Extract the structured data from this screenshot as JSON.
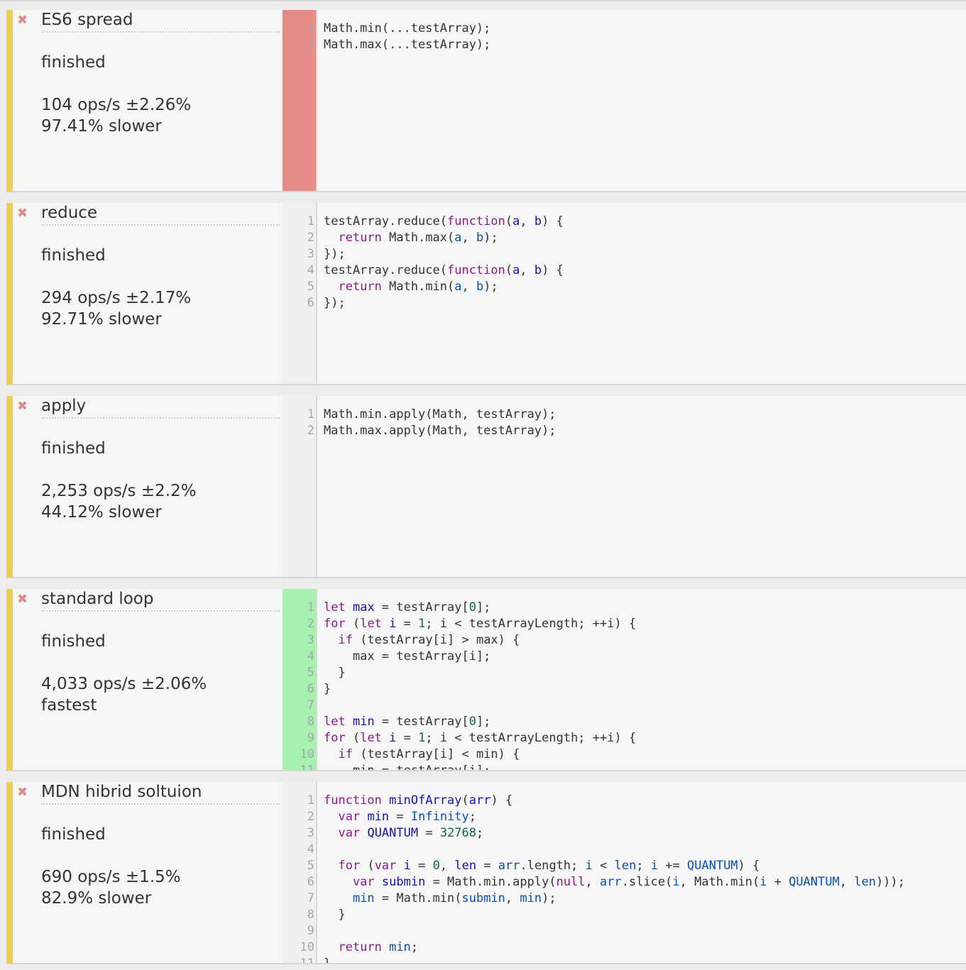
{
  "tests": [
    {
      "title": "ES6 spread",
      "status": "finished",
      "ops": "104 ops/s ±2.26%",
      "relative": "97.41% slower",
      "result": "slowest",
      "gutter_color": "#e58c89",
      "code": [
        [
          [
            "pl",
            "Math.min(...testArray);"
          ]
        ],
        [
          [
            "pl",
            "Math.max(...testArray);"
          ]
        ]
      ]
    },
    {
      "title": "reduce",
      "status": "finished",
      "ops": "294 ops/s ±2.17%",
      "relative": "92.71% slower",
      "result": "normal",
      "gutter_color": "#f0f0f0",
      "code": [
        [
          [
            "pl",
            "testArray.reduce("
          ],
          [
            "kw",
            "function"
          ],
          [
            "pl",
            "("
          ],
          [
            "def",
            "a"
          ],
          [
            "pl",
            ", "
          ],
          [
            "def",
            "b"
          ],
          [
            "pl",
            ") {"
          ]
        ],
        [
          [
            "pl",
            "  "
          ],
          [
            "kw",
            "return"
          ],
          [
            "pl",
            " Math.max("
          ],
          [
            "vr",
            "a"
          ],
          [
            "pl",
            ", "
          ],
          [
            "vr",
            "b"
          ],
          [
            "pl",
            ");"
          ]
        ],
        [
          [
            "pl",
            "});"
          ]
        ],
        [
          [
            "pl",
            "testArray.reduce("
          ],
          [
            "kw",
            "function"
          ],
          [
            "pl",
            "("
          ],
          [
            "def",
            "a"
          ],
          [
            "pl",
            ", "
          ],
          [
            "def",
            "b"
          ],
          [
            "pl",
            ") {"
          ]
        ],
        [
          [
            "pl",
            "  "
          ],
          [
            "kw",
            "return"
          ],
          [
            "pl",
            " Math.min("
          ],
          [
            "vr",
            "a"
          ],
          [
            "pl",
            ", "
          ],
          [
            "vr",
            "b"
          ],
          [
            "pl",
            ");"
          ]
        ],
        [
          [
            "pl",
            "});"
          ]
        ]
      ]
    },
    {
      "title": "apply",
      "status": "finished",
      "ops": "2,253 ops/s ±2.2%",
      "relative": "44.12% slower",
      "result": "normal",
      "gutter_color": "#f0f0f0",
      "code": [
        [
          [
            "pl",
            "Math.min.apply(Math, testArray);"
          ]
        ],
        [
          [
            "pl",
            "Math.max.apply(Math, testArray);"
          ]
        ]
      ]
    },
    {
      "title": "standard loop",
      "status": "finished",
      "ops": "4,033 ops/s ±2.06%",
      "relative": "fastest",
      "result": "fastest",
      "gutter_color": "#a6f0b0",
      "code": [
        [
          [
            "kw",
            "let"
          ],
          [
            "pl",
            " "
          ],
          [
            "def",
            "max"
          ],
          [
            "pl",
            " = testArray["
          ],
          [
            "num",
            "0"
          ],
          [
            "pl",
            "];"
          ]
        ],
        [
          [
            "kw",
            "for"
          ],
          [
            "pl",
            " ("
          ],
          [
            "kw",
            "let"
          ],
          [
            "pl",
            " "
          ],
          [
            "def",
            "i"
          ],
          [
            "pl",
            " = "
          ],
          [
            "num",
            "1"
          ],
          [
            "pl",
            "; i < testArrayLength; ++i) {"
          ]
        ],
        [
          [
            "pl",
            "  "
          ],
          [
            "kw",
            "if"
          ],
          [
            "pl",
            " (testArray[i] > max) {"
          ]
        ],
        [
          [
            "pl",
            "    max = testArray[i];"
          ]
        ],
        [
          [
            "pl",
            "  }"
          ]
        ],
        [
          [
            "pl",
            "}"
          ]
        ],
        [
          [
            "pl",
            ""
          ]
        ],
        [
          [
            "kw",
            "let"
          ],
          [
            "pl",
            " "
          ],
          [
            "def",
            "min"
          ],
          [
            "pl",
            " = testArray["
          ],
          [
            "num",
            "0"
          ],
          [
            "pl",
            "];"
          ]
        ],
        [
          [
            "kw",
            "for"
          ],
          [
            "pl",
            " ("
          ],
          [
            "kw",
            "let"
          ],
          [
            "pl",
            " "
          ],
          [
            "def",
            "i"
          ],
          [
            "pl",
            " = "
          ],
          [
            "num",
            "1"
          ],
          [
            "pl",
            "; i < testArrayLength; ++i) {"
          ]
        ],
        [
          [
            "pl",
            "  "
          ],
          [
            "kw",
            "if"
          ],
          [
            "pl",
            " (testArray[i] < min) {"
          ]
        ],
        [
          [
            "pl",
            "    min = testArray[i];"
          ]
        ]
      ]
    },
    {
      "title": "MDN hibrid soltuion",
      "status": "finished",
      "ops": "690 ops/s ±1.5%",
      "relative": "82.9% slower",
      "result": "normal",
      "gutter_color": "#f0f0f0",
      "code": [
        [
          [
            "kw",
            "function"
          ],
          [
            "pl",
            " "
          ],
          [
            "def",
            "minOfArray"
          ],
          [
            "pl",
            "("
          ],
          [
            "def",
            "arr"
          ],
          [
            "pl",
            ") {"
          ]
        ],
        [
          [
            "pl",
            "  "
          ],
          [
            "kw",
            "var"
          ],
          [
            "pl",
            " "
          ],
          [
            "def",
            "min"
          ],
          [
            "pl",
            " = "
          ],
          [
            "vr",
            "Infinity"
          ],
          [
            "pl",
            ";"
          ]
        ],
        [
          [
            "pl",
            "  "
          ],
          [
            "kw",
            "var"
          ],
          [
            "pl",
            " "
          ],
          [
            "def",
            "QUANTUM"
          ],
          [
            "pl",
            " = "
          ],
          [
            "num",
            "32768"
          ],
          [
            "pl",
            ";"
          ]
        ],
        [
          [
            "pl",
            ""
          ]
        ],
        [
          [
            "pl",
            "  "
          ],
          [
            "kw",
            "for"
          ],
          [
            "pl",
            " ("
          ],
          [
            "kw",
            "var"
          ],
          [
            "pl",
            " "
          ],
          [
            "def",
            "i"
          ],
          [
            "pl",
            " = "
          ],
          [
            "num",
            "0"
          ],
          [
            "pl",
            ", "
          ],
          [
            "def",
            "len"
          ],
          [
            "pl",
            " = "
          ],
          [
            "vr",
            "arr"
          ],
          [
            "pl",
            ".length; "
          ],
          [
            "vr",
            "i"
          ],
          [
            "pl",
            " < "
          ],
          [
            "vr",
            "len"
          ],
          [
            "pl",
            "; "
          ],
          [
            "vr",
            "i"
          ],
          [
            "pl",
            " += "
          ],
          [
            "vr",
            "QUANTUM"
          ],
          [
            "pl",
            ") {"
          ]
        ],
        [
          [
            "pl",
            "    "
          ],
          [
            "kw",
            "var"
          ],
          [
            "pl",
            " "
          ],
          [
            "def",
            "submin"
          ],
          [
            "pl",
            " = Math.min.apply("
          ],
          [
            "kw",
            "null"
          ],
          [
            "pl",
            ", "
          ],
          [
            "vr",
            "arr"
          ],
          [
            "pl",
            ".slice("
          ],
          [
            "vr",
            "i"
          ],
          [
            "pl",
            ", Math.min("
          ],
          [
            "vr",
            "i"
          ],
          [
            "pl",
            " + "
          ],
          [
            "vr",
            "QUANTUM"
          ],
          [
            "pl",
            ", "
          ],
          [
            "vr",
            "len"
          ],
          [
            "pl",
            ")));"
          ]
        ],
        [
          [
            "pl",
            "    "
          ],
          [
            "vr",
            "min"
          ],
          [
            "pl",
            " = Math.min("
          ],
          [
            "vr",
            "submin"
          ],
          [
            "pl",
            ", "
          ],
          [
            "vr",
            "min"
          ],
          [
            "pl",
            ");"
          ]
        ],
        [
          [
            "pl",
            "  }"
          ]
        ],
        [
          [
            "pl",
            ""
          ]
        ],
        [
          [
            "pl",
            "  "
          ],
          [
            "kw",
            "return"
          ],
          [
            "pl",
            " "
          ],
          [
            "vr",
            "min"
          ],
          [
            "pl",
            ";"
          ]
        ],
        [
          [
            "pl",
            "}"
          ]
        ]
      ]
    }
  ]
}
